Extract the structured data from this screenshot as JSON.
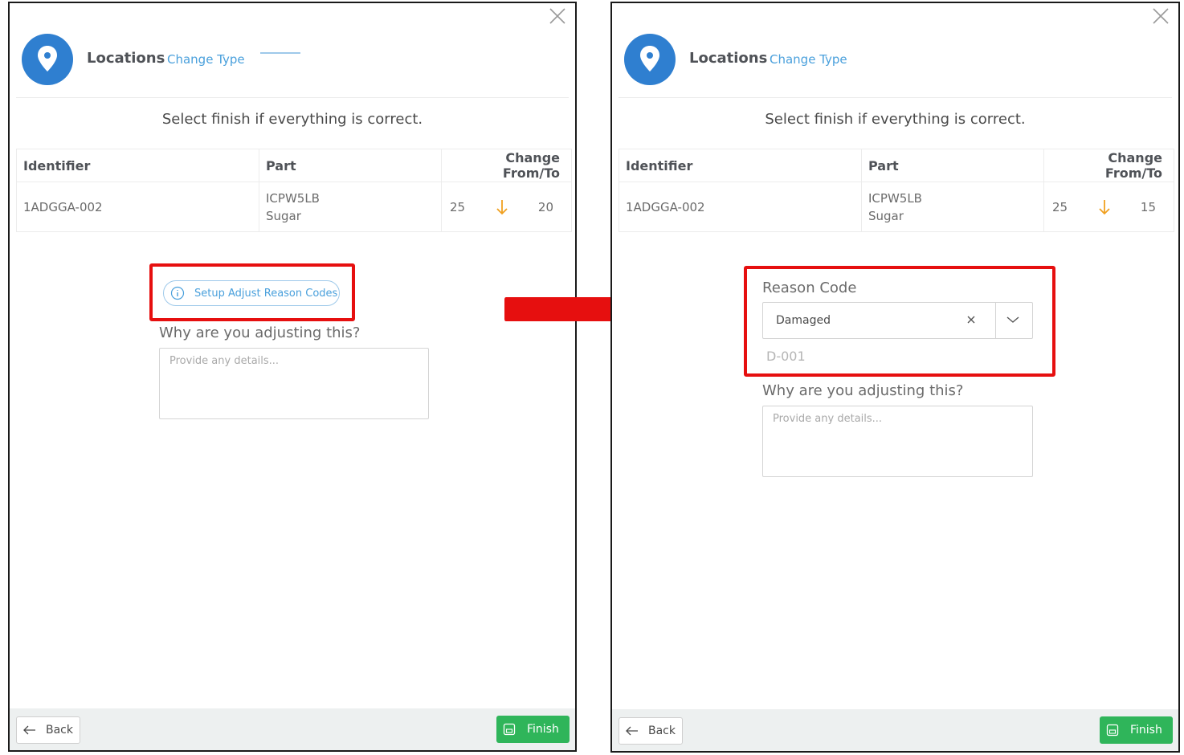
{
  "left_panel": {
    "header": {
      "title": "Locations",
      "change_type": "Change Type"
    },
    "instruction": "Select finish if everything is correct.",
    "table": {
      "headers": {
        "identifier": "Identifier",
        "part": "Part",
        "change": "Change From/To"
      },
      "row": {
        "identifier": "1ADGGA-002",
        "part_code": "ICPW5LB",
        "part_desc": "Sugar",
        "from": "25",
        "to": "20"
      }
    },
    "setup_button": "Setup Adjust Reason Codes",
    "question": "Why are you adjusting this?",
    "details_placeholder": "Provide any details...",
    "footer": {
      "back": "Back",
      "finish": "Finish"
    }
  },
  "right_panel": {
    "header": {
      "title": "Locations",
      "change_type": "Change Type"
    },
    "instruction": "Select finish if everything is correct.",
    "table": {
      "headers": {
        "identifier": "Identifier",
        "part": "Part",
        "change": "Change From/To"
      },
      "row": {
        "identifier": "1ADGGA-002",
        "part_code": "ICPW5LB",
        "part_desc": "Sugar",
        "from": "25",
        "to": "15"
      }
    },
    "reason_code": {
      "label": "Reason Code",
      "selected": "Damaged",
      "code": "D-001"
    },
    "question": "Why are you adjusting this?",
    "details_placeholder": "Provide any details...",
    "footer": {
      "back": "Back",
      "finish": "Finish"
    }
  },
  "colors": {
    "primary_blue": "#2f7fd0",
    "link_blue": "#4aa0dc",
    "highlight_red": "#e60f0f",
    "finish_green": "#2fb55a",
    "arrow_orange": "#f0a020"
  },
  "icons": [
    "close-icon",
    "location-pin-icon",
    "arrow-down-icon",
    "info-icon",
    "back-arrow-icon",
    "save-icon",
    "clear-icon",
    "chevron-down-icon",
    "right-arrow-icon"
  ]
}
